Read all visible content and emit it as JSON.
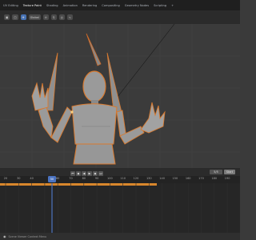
{
  "top_tabs": [
    "UV Editing",
    "Texture Paint",
    "Shading",
    "Animation",
    "Rendering",
    "Compositing",
    "Geometry Nodes",
    "Scripting",
    "+"
  ],
  "active_tab_index": 1,
  "header": {
    "transform_orientation": "Global"
  },
  "timeline": {
    "current_frame": "50",
    "frame_ticks": [
      "20",
      "30",
      "40",
      "50",
      "60",
      "70",
      "80",
      "90",
      "100",
      "110",
      "120",
      "130",
      "140",
      "150",
      "160",
      "170",
      "180",
      "190"
    ],
    "start_label": "5/5",
    "end_label": "Start"
  },
  "status": {
    "text": "Scene Viewer Context Menu"
  },
  "colors": {
    "accent": "#4772b3",
    "selection_outline": "#e07a2a",
    "keyframe_range": "#d8872c"
  }
}
